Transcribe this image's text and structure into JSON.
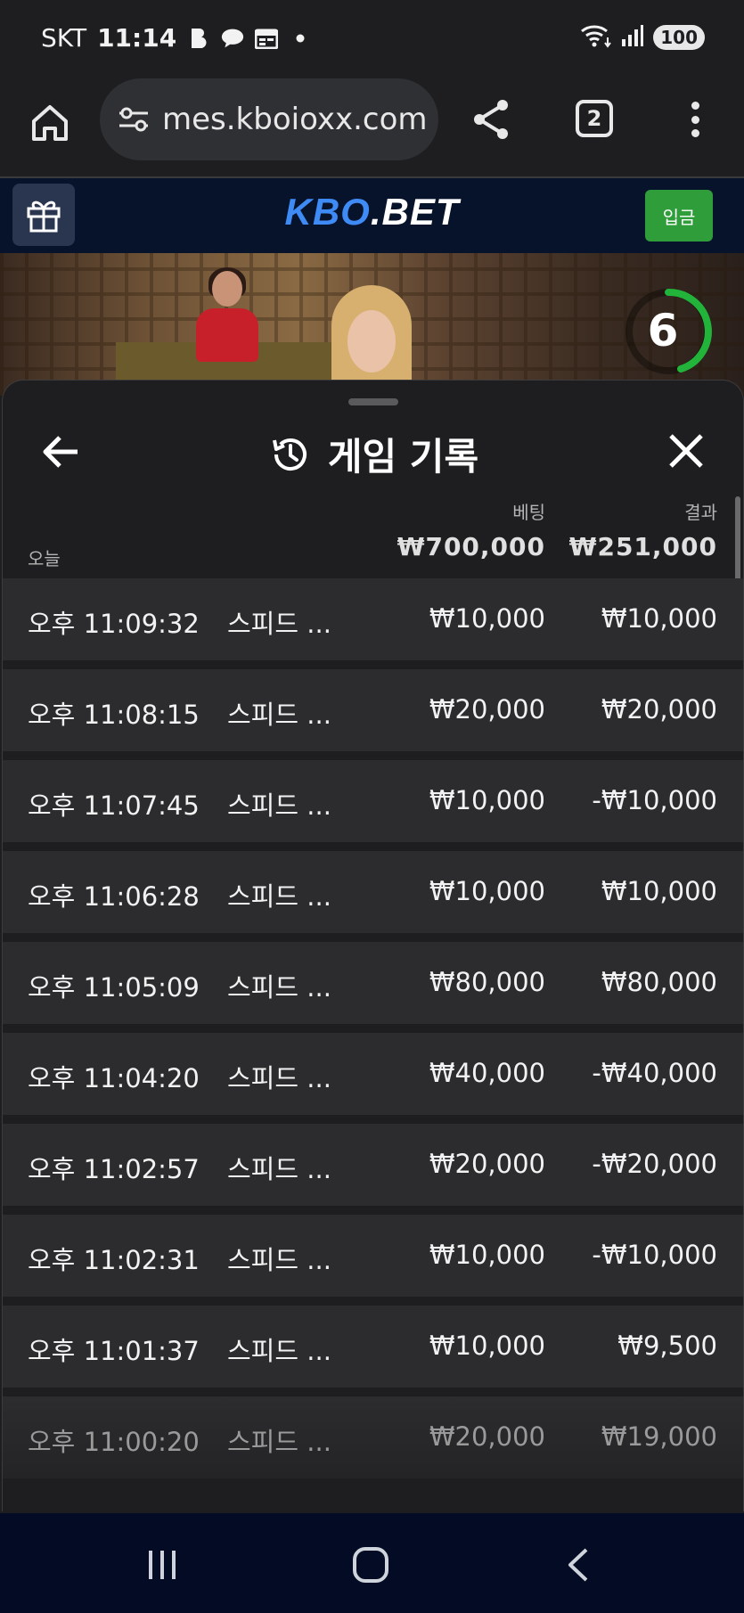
{
  "status_bar": {
    "carrier": "SKT",
    "time": "11:14",
    "icons": [
      "b-app-icon",
      "talk-icon",
      "calendar-icon",
      "dot-icon"
    ],
    "right_icons": [
      "wifi-icon",
      "signal-icon"
    ],
    "battery": "100"
  },
  "browser": {
    "url": "mes.kboioxx.com",
    "tab_count": "2"
  },
  "site": {
    "logo_main": "KBO",
    "logo_dot": ".BET",
    "deposit_label": "입금",
    "brand_color": "#3f8bf5",
    "deposit_color": "#2e9d3a"
  },
  "video": {
    "countdown": "6"
  },
  "history": {
    "title": "게임 기록",
    "bet_header": "베팅",
    "result_header": "결과",
    "today_label": "오늘",
    "bet_total": "₩700,000",
    "result_total": "₩251,000",
    "rows": [
      {
        "time": "오후 11:09:32",
        "game": "스피드 ...",
        "bet": "₩10,000",
        "result": "₩10,000"
      },
      {
        "time": "오후 11:08:15",
        "game": "스피드 ...",
        "bet": "₩20,000",
        "result": "₩20,000"
      },
      {
        "time": "오후 11:07:45",
        "game": "스피드 ...",
        "bet": "₩10,000",
        "result": "-₩10,000"
      },
      {
        "time": "오후 11:06:28",
        "game": "스피드 ...",
        "bet": "₩10,000",
        "result": "₩10,000"
      },
      {
        "time": "오후 11:05:09",
        "game": "스피드 ...",
        "bet": "₩80,000",
        "result": "₩80,000"
      },
      {
        "time": "오후 11:04:20",
        "game": "스피드 ...",
        "bet": "₩40,000",
        "result": "-₩40,000"
      },
      {
        "time": "오후 11:02:57",
        "game": "스피드 ...",
        "bet": "₩20,000",
        "result": "-₩20,000"
      },
      {
        "time": "오후 11:02:31",
        "game": "스피드 ...",
        "bet": "₩10,000",
        "result": "-₩10,000"
      },
      {
        "time": "오후 11:01:37",
        "game": "스피드 ...",
        "bet": "₩10,000",
        "result": "₩9,500"
      },
      {
        "time": "오후 11:00:20",
        "game": "스피드 ...",
        "bet": "₩20,000",
        "result": "₩19,000"
      }
    ]
  }
}
